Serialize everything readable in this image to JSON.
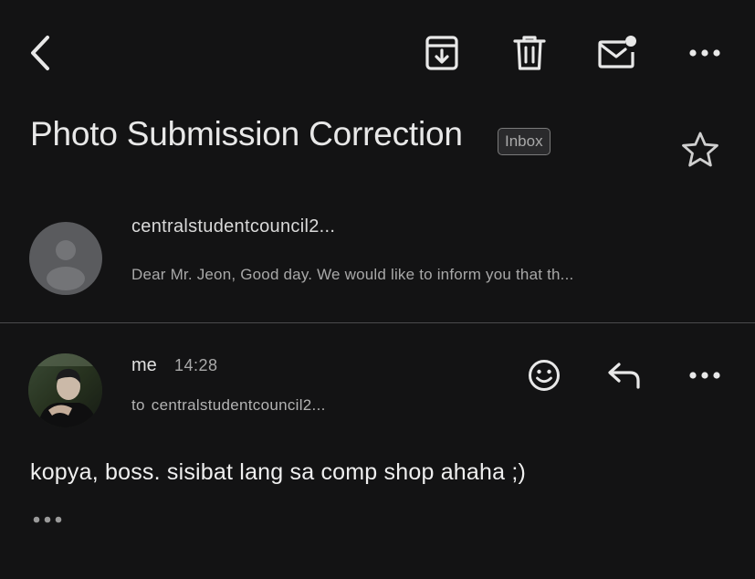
{
  "toolbar": {
    "back_icon": "chevron-left-icon",
    "archive_icon": "archive-icon",
    "delete_icon": "trash-icon",
    "mark_unread_icon": "mail-unread-icon",
    "more_icon": "more-horizontal-icon"
  },
  "thread": {
    "subject": "Photo Submission Correction",
    "label": "Inbox",
    "star_icon": "star-outline-icon"
  },
  "messages": [
    {
      "sender": "centralstudentcouncil2...",
      "snippet": "Dear Mr. Jeon, Good day. We would like to inform you that th...",
      "avatar": "generic-person-avatar"
    },
    {
      "sender": "me",
      "time": "14:28",
      "to_label": "to",
      "recipient": "centralstudentcouncil2...",
      "body": "kopya, boss. sisibat lang sa comp shop ahaha ;)",
      "avatar": "profile-photo-avatar",
      "actions": [
        "emoji-reaction-icon",
        "reply-icon",
        "more-horizontal-icon"
      ]
    }
  ],
  "colors": {
    "background": "#131314",
    "text": "#e6e6e6",
    "muted": "#a8a8a8",
    "divider": "#4a4a4c"
  }
}
